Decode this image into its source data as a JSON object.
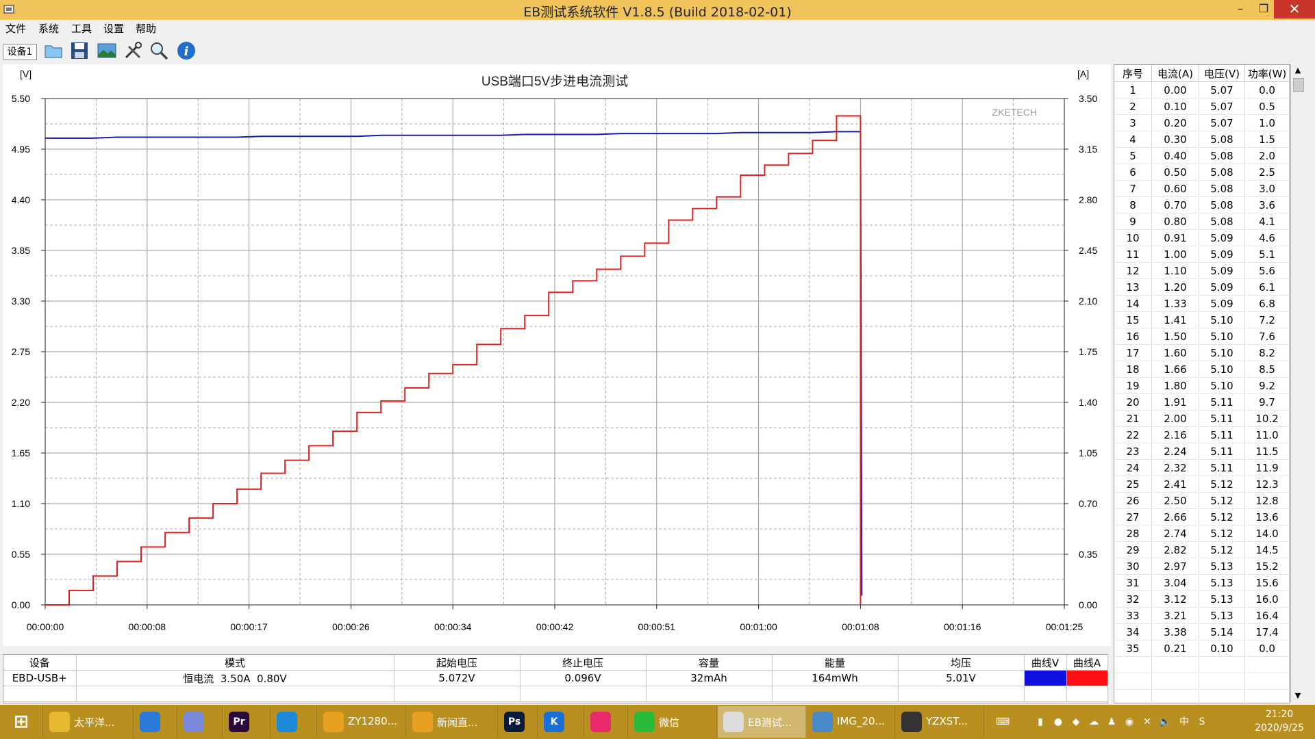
{
  "window": {
    "title": "EB测试系统软件 V1.8.5 (Build 2018-02-01)",
    "minimize": "–",
    "maximize": "❐",
    "close": "✕"
  },
  "menu": [
    "文件",
    "系统",
    "工具",
    "设置",
    "帮助"
  ],
  "toolbar": {
    "device_tab": "设备1",
    "tools": [
      "open-folder-icon",
      "save-icon",
      "image-icon",
      "tools-icon",
      "zoom-icon",
      "info-icon"
    ]
  },
  "chart_data": {
    "type": "line",
    "title": "USB端口5V步进电流测试",
    "watermark": "ZKETECH",
    "ylabel_left": "[V]",
    "ylabel_right": "[A]",
    "ylim_left": [
      0,
      5.5
    ],
    "ylim_right": [
      0,
      3.5
    ],
    "yticks_left": [
      "0.00",
      "0.55",
      "1.10",
      "1.65",
      "2.20",
      "2.75",
      "3.30",
      "3.85",
      "4.40",
      "4.95",
      "5.50"
    ],
    "yticks_right": [
      "0.00",
      "0.35",
      "0.70",
      "1.05",
      "1.40",
      "1.75",
      "2.10",
      "2.45",
      "2.80",
      "3.15",
      "3.50"
    ],
    "xticks": [
      "00:00:00",
      "00:00:08",
      "00:00:17",
      "00:00:26",
      "00:00:34",
      "00:00:42",
      "00:00:51",
      "00:01:00",
      "00:01:08",
      "00:01:16",
      "00:01:25"
    ],
    "xlim_seconds": [
      0,
      85
    ],
    "series": [
      {
        "name": "曲线V",
        "axis": "left",
        "color": "#1a1aa8",
        "x": [
          0,
          2,
          4,
          6,
          8,
          10,
          12,
          14,
          16,
          18,
          20,
          22,
          24,
          26,
          28,
          30,
          32,
          34,
          36,
          38,
          40,
          42,
          44,
          46,
          48,
          50,
          52,
          54,
          56,
          58,
          60,
          62,
          64,
          66,
          68,
          68.1,
          68.1
        ],
        "y": [
          5.07,
          5.07,
          5.07,
          5.08,
          5.08,
          5.08,
          5.08,
          5.08,
          5.08,
          5.09,
          5.09,
          5.09,
          5.09,
          5.09,
          5.1,
          5.1,
          5.1,
          5.1,
          5.1,
          5.1,
          5.11,
          5.11,
          5.11,
          5.11,
          5.12,
          5.12,
          5.12,
          5.12,
          5.12,
          5.13,
          5.13,
          5.13,
          5.13,
          5.14,
          5.14,
          0.3,
          0.1
        ]
      },
      {
        "name": "曲线A",
        "axis": "right",
        "color": "#e02020",
        "x": [
          0,
          2,
          4,
          6,
          8,
          10,
          12,
          14,
          16,
          18,
          20,
          22,
          24,
          26,
          28,
          30,
          32,
          34,
          36,
          38,
          40,
          42,
          44,
          46,
          48,
          50,
          52,
          54,
          56,
          58,
          60,
          62,
          64,
          66,
          68
        ],
        "y": [
          0.0,
          0.1,
          0.2,
          0.3,
          0.4,
          0.5,
          0.6,
          0.7,
          0.8,
          0.91,
          1.0,
          1.1,
          1.2,
          1.33,
          1.41,
          1.5,
          1.6,
          1.66,
          1.8,
          1.91,
          2.0,
          2.16,
          2.24,
          2.32,
          2.41,
          2.5,
          2.66,
          2.74,
          2.82,
          2.97,
          3.04,
          3.12,
          3.21,
          3.38,
          0.0
        ]
      }
    ]
  },
  "table": {
    "headers": [
      "序号",
      "电流(A)",
      "电压(V)",
      "功率(W)"
    ],
    "rows": [
      [
        "1",
        "0.00",
        "5.07",
        "0.0"
      ],
      [
        "2",
        "0.10",
        "5.07",
        "0.5"
      ],
      [
        "3",
        "0.20",
        "5.07",
        "1.0"
      ],
      [
        "4",
        "0.30",
        "5.08",
        "1.5"
      ],
      [
        "5",
        "0.40",
        "5.08",
        "2.0"
      ],
      [
        "6",
        "0.50",
        "5.08",
        "2.5"
      ],
      [
        "7",
        "0.60",
        "5.08",
        "3.0"
      ],
      [
        "8",
        "0.70",
        "5.08",
        "3.6"
      ],
      [
        "9",
        "0.80",
        "5.08",
        "4.1"
      ],
      [
        "10",
        "0.91",
        "5.09",
        "4.6"
      ],
      [
        "11",
        "1.00",
        "5.09",
        "5.1"
      ],
      [
        "12",
        "1.10",
        "5.09",
        "5.6"
      ],
      [
        "13",
        "1.20",
        "5.09",
        "6.1"
      ],
      [
        "14",
        "1.33",
        "5.09",
        "6.8"
      ],
      [
        "15",
        "1.41",
        "5.10",
        "7.2"
      ],
      [
        "16",
        "1.50",
        "5.10",
        "7.6"
      ],
      [
        "17",
        "1.60",
        "5.10",
        "8.2"
      ],
      [
        "18",
        "1.66",
        "5.10",
        "8.5"
      ],
      [
        "19",
        "1.80",
        "5.10",
        "9.2"
      ],
      [
        "20",
        "1.91",
        "5.11",
        "9.7"
      ],
      [
        "21",
        "2.00",
        "5.11",
        "10.2"
      ],
      [
        "22",
        "2.16",
        "5.11",
        "11.0"
      ],
      [
        "23",
        "2.24",
        "5.11",
        "11.5"
      ],
      [
        "24",
        "2.32",
        "5.11",
        "11.9"
      ],
      [
        "25",
        "2.41",
        "5.12",
        "12.3"
      ],
      [
        "26",
        "2.50",
        "5.12",
        "12.8"
      ],
      [
        "27",
        "2.66",
        "5.12",
        "13.6"
      ],
      [
        "28",
        "2.74",
        "5.12",
        "14.0"
      ],
      [
        "29",
        "2.82",
        "5.12",
        "14.5"
      ],
      [
        "30",
        "2.97",
        "5.13",
        "15.2"
      ],
      [
        "31",
        "3.04",
        "5.13",
        "15.6"
      ],
      [
        "32",
        "3.12",
        "5.13",
        "16.0"
      ],
      [
        "33",
        "3.21",
        "5.13",
        "16.4"
      ],
      [
        "34",
        "3.38",
        "5.14",
        "17.4"
      ],
      [
        "35",
        "0.21",
        "0.10",
        "0.0"
      ]
    ]
  },
  "summary": {
    "headers": [
      "设备",
      "模式",
      "起始电压",
      "终止电压",
      "容量",
      "能量",
      "均压",
      "曲线V",
      "曲线A"
    ],
    "values": [
      "EBD-USB+",
      "恒电流  3.50A  0.80V",
      "5.072V",
      "0.096V",
      "32mAh",
      "164mWh",
      "5.01V"
    ],
    "curve_v_color": "#1010e0",
    "curve_a_color": "#ff1010"
  },
  "taskbar": {
    "items": [
      {
        "label": "",
        "icon": "windows-start-icon"
      },
      {
        "label": "太平洋...",
        "icon": "folder-icon"
      },
      {
        "label": "",
        "icon": "sogou-icon"
      },
      {
        "label": "",
        "icon": "bird-icon"
      },
      {
        "label": "",
        "icon": "premiere-icon",
        "glyph": "Pr"
      },
      {
        "label": "",
        "icon": "browser-icon"
      },
      {
        "label": "ZY1280...",
        "icon": "chrome-icon"
      },
      {
        "label": "新闻直...",
        "icon": "chrome-icon"
      },
      {
        "label": "",
        "icon": "photoshop-icon",
        "glyph": "Ps"
      },
      {
        "label": "",
        "icon": "kugou-icon",
        "glyph": "K"
      },
      {
        "label": "",
        "icon": "youku-icon"
      },
      {
        "label": "微信",
        "icon": "wechat-icon"
      },
      {
        "label": "EB测试...",
        "icon": "eb-app-icon"
      },
      {
        "label": "IMG_20...",
        "icon": "image-viewer-icon"
      },
      {
        "label": "YZXST...",
        "icon": "app-icon"
      }
    ],
    "clock_time": "21:20",
    "clock_date": "2020/9/25"
  }
}
